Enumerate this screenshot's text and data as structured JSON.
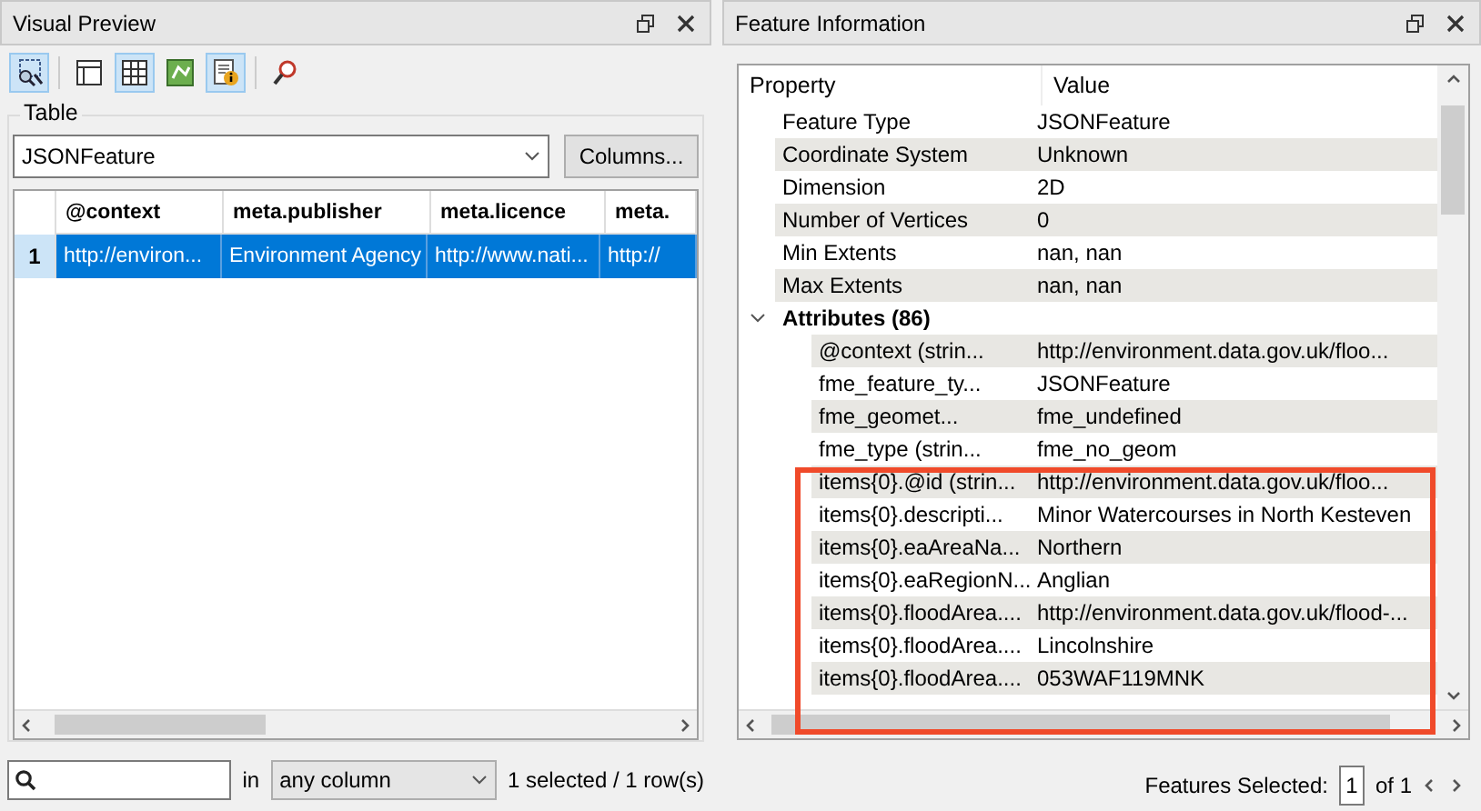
{
  "visual_preview": {
    "title": "Visual Preview",
    "toolbar": [
      {
        "kind": "select",
        "selected": true
      },
      {
        "kind": "layout",
        "selected": false
      },
      {
        "kind": "table",
        "selected": true
      },
      {
        "kind": "graphics",
        "selected": false
      },
      {
        "kind": "info",
        "selected": true
      },
      {
        "kind": "inspect",
        "selected": false
      }
    ],
    "group_label": "Table",
    "feature_type": "JSONFeature",
    "columns_button": "Columns...",
    "table": {
      "columns": [
        "@context",
        "meta.publisher",
        "meta.licence",
        "meta."
      ],
      "rows": [
        {
          "number": "1",
          "selected": true,
          "cells": [
            "http://environ...",
            "Environment Agency",
            "http://www.nati...",
            "http://"
          ]
        }
      ]
    },
    "search": {
      "in_label": "in",
      "column_filter": "any column",
      "status": "1 selected / 1 row(s)"
    }
  },
  "feature_information": {
    "title": "Feature Information",
    "columns": [
      "Property",
      "Value"
    ],
    "properties": [
      {
        "property": "Feature Type",
        "value": "JSONFeature"
      },
      {
        "property": "Coordinate System",
        "value": "Unknown"
      },
      {
        "property": "Dimension",
        "value": "2D"
      },
      {
        "property": "Number of Vertices",
        "value": "0"
      },
      {
        "property": "Min Extents",
        "value": "nan, nan"
      },
      {
        "property": "Max Extents",
        "value": "nan, nan"
      }
    ],
    "attributes": {
      "label": "Attributes (86)",
      "expanded": true,
      "children": [
        {
          "property": "@context (strin...",
          "value": "http://environment.data.gov.uk/floo..."
        },
        {
          "property": "fme_feature_ty...",
          "value": "JSONFeature"
        },
        {
          "property": "fme_geomet...",
          "value": "fme_undefined"
        },
        {
          "property": "fme_type (strin...",
          "value": "fme_no_geom"
        },
        {
          "property": "items{0}.@id (strin...",
          "value": "http://environment.data.gov.uk/floo..."
        },
        {
          "property": "items{0}.descripti...",
          "value": "Minor Watercourses in North Kesteven"
        },
        {
          "property": "items{0}.eaAreaNa...",
          "value": "Northern"
        },
        {
          "property": "items{0}.eaRegionN...",
          "value": "Anglian"
        },
        {
          "property": "items{0}.floodArea....",
          "value": "http://environment.data.gov.uk/flood-..."
        },
        {
          "property": "items{0}.floodArea....",
          "value": "Lincolnshire"
        },
        {
          "property": "items{0}.floodArea....",
          "value": "053WAF119MNK"
        }
      ]
    },
    "features_selected_label": "Features Selected:",
    "page": "1",
    "page_total": "of 1"
  }
}
